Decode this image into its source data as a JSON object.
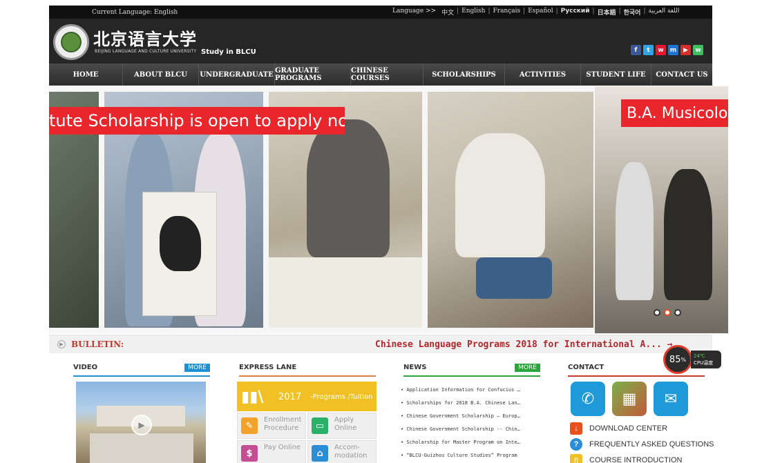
{
  "topbar": {
    "current_language": "Current Language: English",
    "language_prefix": "Language >>",
    "languages": [
      "中文",
      "English",
      "Français",
      "Español",
      "Русский",
      "日本語",
      "한국어",
      "اللغة العربية"
    ]
  },
  "header": {
    "logo_cn": "北京语言大学",
    "logo_en": "BEIJING LANGUAGE AND CULTURE UNIVERSITY",
    "study": "Study in BLCU",
    "social": [
      {
        "icon": "facebook-icon",
        "glyph": "f",
        "color": "#3b5998"
      },
      {
        "icon": "twitter-icon",
        "glyph": "t",
        "color": "#2fa4e7"
      },
      {
        "icon": "weibo-icon",
        "glyph": "w",
        "color": "#e6162d"
      },
      {
        "icon": "messenger-icon",
        "glyph": "m",
        "color": "#1e73d8"
      },
      {
        "icon": "youtube-icon",
        "glyph": "▶",
        "color": "#d62d2d"
      },
      {
        "icon": "wechat-icon",
        "glyph": "w",
        "color": "#3fbf5e"
      }
    ]
  },
  "nav": [
    {
      "label": "HOME",
      "width": 107
    },
    {
      "label": "ABOUT BLCU",
      "width": 110
    },
    {
      "label": "UNDERGRADUATE",
      "width": 110
    },
    {
      "label": "GRADUATE PROGRAMS",
      "width": 110
    },
    {
      "label": "CHINESE COURSES",
      "width": 105
    },
    {
      "label": "SCHOLARSHIPS",
      "width": 118
    },
    {
      "label": "ACTIVITIES",
      "width": 110
    },
    {
      "label": "STUDENT LIFE",
      "width": 102
    },
    {
      "label": "CONTACT US",
      "width": 88
    }
  ],
  "banner": {
    "caption_left": "tute Scholarship is open to apply now!",
    "caption_right": "B.A. Musicolo",
    "dots": [
      false,
      true,
      false
    ]
  },
  "bulletin": {
    "label": "BULLETIN:",
    "text": "Chinese Language Programs 2018 for International A... →"
  },
  "video": {
    "title": "VIDEO",
    "more": "MORE"
  },
  "express": {
    "title": "EXPRESS LANE",
    "year": "2017",
    "programs": "-Programs /Tuition",
    "tiles": [
      {
        "name": "enrollment-procedure",
        "label": "Enrollment Procedure",
        "color": "#f2a12b",
        "glyph": "✎"
      },
      {
        "name": "apply-online",
        "label": "Apply Online",
        "color": "#2bb06a",
        "glyph": "▭"
      },
      {
        "name": "pay-online",
        "label": "Pay Online",
        "color": "#c44d94",
        "glyph": "$"
      },
      {
        "name": "accommodation",
        "label": "Accom-modation",
        "color": "#2a8dd6",
        "glyph": "⌂"
      }
    ]
  },
  "news": {
    "title": "NEWS",
    "more": "MORE",
    "items": [
      "• Application Information for Confucius …",
      "• Scholarships for 2018 B.A. Chinese Lan…",
      "• Chinese Government Scholarship — Europ…",
      "• Chinese Government Scholarship -- Chin…",
      "• Scholarship for Master Program on Inte…",
      "• “BLCU-Guizhou Culture Studies” Program"
    ]
  },
  "contact": {
    "title": "CONTACT",
    "links": [
      "DOWNLOAD CENTER",
      "FREQUENTLY ASKED QUESTIONS",
      "COURSE INTRODUCTION"
    ]
  },
  "cpu": {
    "percent": "85",
    "unit": "%",
    "temp": "24℃",
    "label": "CPU温度"
  }
}
